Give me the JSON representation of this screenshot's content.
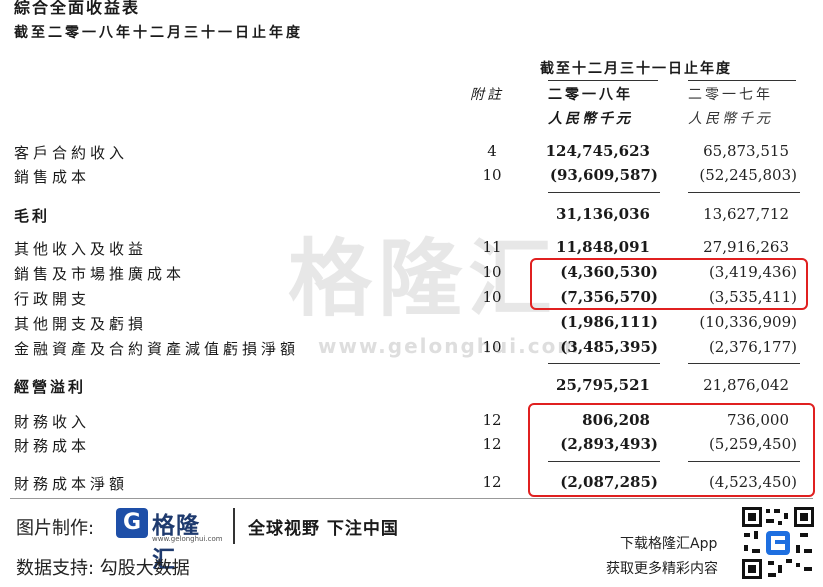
{
  "doc": {
    "title": "綜合全面收益表",
    "subtitle": "截至二零一八年十二月三十一日止年度"
  },
  "header": {
    "period": "截至十二月三十一日止年度",
    "note": "附註",
    "year1": "二零一八年",
    "year2": "二零一七年",
    "unit1": "人民幣千元",
    "unit2": "人民幣千元"
  },
  "rows": [
    {
      "label": "客戶合約收入",
      "note": "4",
      "y2018": "124,745,623",
      "y2017": "65,873,515"
    },
    {
      "label": "銷售成本",
      "note": "10",
      "y2018": "(93,609,587)",
      "y2017": "(52,245,803)"
    },
    {
      "label": "毛利",
      "note": "",
      "y2018": "31,136,036",
      "y2017": "13,627,712"
    },
    {
      "label": "其他收入及收益",
      "note": "11",
      "y2018": "11,848,091",
      "y2017": "27,916,263"
    },
    {
      "label": "銷售及市場推廣成本",
      "note": "10",
      "y2018": "(4,360,530)",
      "y2017": "(3,419,436)"
    },
    {
      "label": "行政開支",
      "note": "10",
      "y2018": "(7,356,570)",
      "y2017": "(3,535,411)"
    },
    {
      "label": "其他開支及虧損",
      "note": "",
      "y2018": "(1,986,111)",
      "y2017": "(10,336,909)"
    },
    {
      "label": "金融資產及合約資產減值虧損淨額",
      "note": "10",
      "y2018": "(3,485,395)",
      "y2017": "(2,376,177)"
    },
    {
      "label": "經營溢利",
      "note": "",
      "y2018": "25,795,521",
      "y2017": "21,876,042"
    },
    {
      "label": "財務收入",
      "note": "12",
      "y2018": "806,208",
      "y2017": "736,000"
    },
    {
      "label": "財務成本",
      "note": "12",
      "y2018": "(2,893,493)",
      "y2017": "(5,259,450)"
    },
    {
      "label": "財務成本淨額",
      "note": "12",
      "y2018": "(2,087,285)",
      "y2017": "(4,523,450)"
    }
  ],
  "watermark": {
    "big": "格隆汇",
    "url": "www.gelonghui.com"
  },
  "footer": {
    "made_by": "图片制作:",
    "logo_icon": "G",
    "logo_text": "格隆汇",
    "logo_url": "www.gelonghui.com",
    "slogan": "全球视野 下注中国",
    "data_support": "数据支持: 勾股大数据",
    "download": "下载格隆汇App",
    "more": "获取更多精彩内容"
  },
  "colors": {
    "highlight": "#e02020",
    "brand": "#1e4fa8"
  }
}
